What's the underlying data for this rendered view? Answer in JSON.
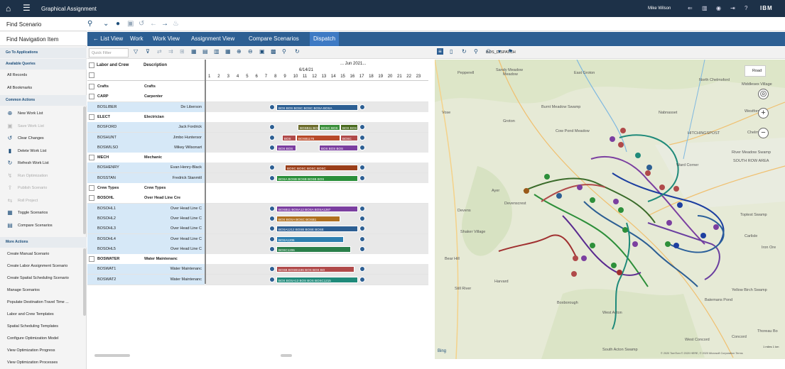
{
  "app": {
    "title": "Graphical Assignment",
    "user": "Mike Wilson",
    "brand": "IBM"
  },
  "left": {
    "find_scenario": "Find Scenario",
    "find_nav": "Find Navigation Item",
    "go_to_apps": "Go To Applications",
    "available_queries": "Available Queries",
    "queries": [
      "All Records",
      "All Bookmarks"
    ],
    "common_actions": "Common Actions",
    "actions": [
      {
        "label": "New Work List",
        "icon": "plus-icon",
        "disabled": false
      },
      {
        "label": "Save Work List",
        "icon": "save-icon",
        "disabled": true
      },
      {
        "label": "Clear Changes",
        "icon": "undo-icon",
        "disabled": false
      },
      {
        "label": "Delete Work List",
        "icon": "trash-icon",
        "disabled": false
      },
      {
        "label": "Refresh Work List",
        "icon": "refresh-icon",
        "disabled": false
      },
      {
        "label": "Run Optimization",
        "icon": "run-icon",
        "disabled": true
      },
      {
        "label": "Publish Scenario",
        "icon": "publish-icon",
        "disabled": true
      },
      {
        "label": "Roll Project",
        "icon": "roll-icon",
        "disabled": true
      },
      {
        "label": "Toggle Scenarios",
        "icon": "toggle-icon",
        "disabled": false
      },
      {
        "label": "Compare Scenarios",
        "icon": "compare-icon",
        "disabled": false
      }
    ],
    "more_actions": "More Actions",
    "more": [
      "Create Manual Scenario",
      "Create Labor Assignment Scenario",
      "Create Spatial Scheduling Scenario",
      "Manage Scenarios",
      "Populate Destination Travel Time ...",
      "Labor and Crew Templates",
      "Spatial Scheduling Templates",
      "Configure Optimization Model",
      "View Optimization Progress",
      "View Optimization Processes"
    ]
  },
  "nav": {
    "back": "List View",
    "tabs": [
      "Work",
      "Work View",
      "Assignment View",
      "Compare Scenarios",
      "Dispatch"
    ],
    "active": "Dispatch"
  },
  "toolbar": {
    "filter_placeholder": "Quick Filter",
    "dataset": "BOS_DISPATCH"
  },
  "grid": {
    "col1": "Labor and Crew",
    "col2": "Description",
    "month": "... Jun 2021...",
    "day": "6/14/21",
    "hours": [
      "1",
      "2",
      "3",
      "4",
      "5",
      "6",
      "7",
      "8",
      "9",
      "10",
      "11",
      "12",
      "13",
      "14",
      "15",
      "16",
      "17",
      "18",
      "19",
      "20",
      "21",
      "22",
      "23"
    ],
    "rows": [
      {
        "code": "Crafts",
        "desc": "Crafts",
        "type": "grp",
        "exp": true
      },
      {
        "code": "CARP",
        "desc": "Carpenter",
        "type": "grp"
      },
      {
        "code": "BOSLIBER",
        "desc": "De Liberson",
        "type": "sel",
        "bars": [
          {
            "s": 0,
            "w": 115,
            "c": "#2d5f93",
            "t": "BOS BOS BOSC BOSC BOSA BOSA"
          }
        ]
      },
      {
        "code": "ELECT",
        "desc": "Electrician",
        "type": "grp"
      },
      {
        "code": "BOSFORD",
        "desc": "Jack Fordrick",
        "type": "sel",
        "bars": [
          {
            "s": 30,
            "w": 30,
            "c": "#6b6b2a",
            "t": "BOSB11 BOS"
          },
          {
            "s": 60,
            "w": 30,
            "c": "#3a8f3a",
            "t": "BOSC BOS"
          },
          {
            "s": 90,
            "w": 25,
            "c": "#4a6b1f",
            "t": "BOS BOS"
          }
        ]
      },
      {
        "code": "BOSHUNT",
        "desc": "Jimbo Huntersor",
        "type": "sel",
        "bars": [
          {
            "s": 8,
            "w": 20,
            "c": "#b04a4a",
            "t": "BOS"
          },
          {
            "s": 28,
            "w": 62,
            "c": "#b84a2a",
            "t": "BOSB1176"
          },
          {
            "s": 90,
            "w": 25,
            "c": "#b04a4a",
            "t": "BOSC"
          }
        ]
      },
      {
        "code": "BOSWILSO",
        "desc": "Mikey Wilsonart",
        "type": "sel",
        "bars": [
          {
            "s": 0,
            "w": 28,
            "c": "#7b3fa0",
            "t": "BOS BOS"
          },
          {
            "s": 60,
            "w": 55,
            "c": "#7b3fa0",
            "t": "BOS BOS BOS"
          }
        ]
      },
      {
        "code": "MECH",
        "desc": "Mechanic",
        "type": "grp"
      },
      {
        "code": "BOSHENRY",
        "desc": "Evan Henry-Black",
        "type": "sel",
        "bars": [
          {
            "s": 12,
            "w": 103,
            "c": "#9a3f1a",
            "t": "BOSC BOSC BOSC BOSC"
          }
        ]
      },
      {
        "code": "BOSSTAN",
        "desc": "Fredrick Stanmitl",
        "type": "sel",
        "bars": [
          {
            "s": 0,
            "w": 115,
            "c": "#2a8f3a",
            "t": "BOSA BOSB BOSB BOSB BOS"
          }
        ]
      },
      {
        "code": "Crew Types",
        "desc": "Crew Types",
        "type": "grp",
        "exp": true
      },
      {
        "code": "BOSOHL",
        "desc": "Over Head Line Cre",
        "type": "grp"
      },
      {
        "code": "BOSOHL1",
        "desc": "Over Head Line C",
        "type": "sel",
        "bars": [
          {
            "s": 0,
            "w": 115,
            "c": "#7b3fa0",
            "t": "BOSB11 BOSA12 BOSA BOSA1287"
          }
        ]
      },
      {
        "code": "BOSOHL2",
        "desc": "Over Head Line C",
        "type": "sel",
        "bars": [
          {
            "s": 0,
            "w": 90,
            "c": "#b0701f",
            "t": "BOS BOSA BOSC BOSB1"
          }
        ]
      },
      {
        "code": "BOSOHL3",
        "desc": "Over Head Line C",
        "type": "sel",
        "bars": [
          {
            "s": 0,
            "w": 115,
            "c": "#2d5f93",
            "t": "BOSA1212 BOSB BOSE BOSE"
          }
        ]
      },
      {
        "code": "BOSOHL4",
        "desc": "Over Head Line C",
        "type": "sel",
        "bars": [
          {
            "s": 0,
            "w": 95,
            "c": "#2d7fb0",
            "t": "BOSA1206"
          }
        ]
      },
      {
        "code": "BOSOHL5",
        "desc": "Over Head Line C",
        "type": "sel",
        "bars": [
          {
            "s": 0,
            "w": 105,
            "c": "#2a7f4a",
            "t": "BOSC1206"
          }
        ]
      },
      {
        "code": "BOSWATER",
        "desc": "Water Maintenanc",
        "type": "grp"
      },
      {
        "code": "BOSWAT1",
        "desc": "Water Maintenanc",
        "type": "sel",
        "bars": [
          {
            "s": 0,
            "w": 110,
            "c": "#b04a4a",
            "t": "BOSB BOSB1186 BOS BOS BO"
          }
        ]
      },
      {
        "code": "BOSWAT2",
        "desc": "Water Maintenanc",
        "type": "sel",
        "bars": [
          {
            "s": 0,
            "w": 115,
            "c": "#1f8a7a",
            "t": "BOS BOSA13 BOS BOS BOSC1215"
          }
        ]
      }
    ]
  },
  "map": {
    "labels": [
      "Pepperell",
      "Sandy Meadow",
      "Meadow",
      "East Groton",
      "North Chelmsford",
      "Middlesex Village",
      "Vose",
      "Burnt Meadow Swamp",
      "Nabnasset",
      "Westford",
      "Groton",
      "Cow Pond Meadow",
      "HITCHINGSPOST",
      "Chelmsford",
      "River Meadow Swamp",
      "Ward Corner",
      "SOUTH ROW AREA",
      "Ayer",
      "Devenscrest",
      "Devens",
      "Toptest Swamp",
      "Shaker Village",
      "Carlisle",
      "Iron Ore",
      "Bear Hill",
      "Harvard",
      "Still River",
      "Boxborough",
      "West Acton",
      "Yellow Birch Swamp",
      "Batemans Pond",
      "Concord",
      "West Concord",
      "Thoreau Bo",
      "South Acton Swamp"
    ],
    "road_button": "Road",
    "bing": "Bing",
    "copyright": "© 2020 TomTom © 2020 HERE, © 2020 Microsoft Corporation Terms",
    "scale": "1 miles  1 km"
  }
}
